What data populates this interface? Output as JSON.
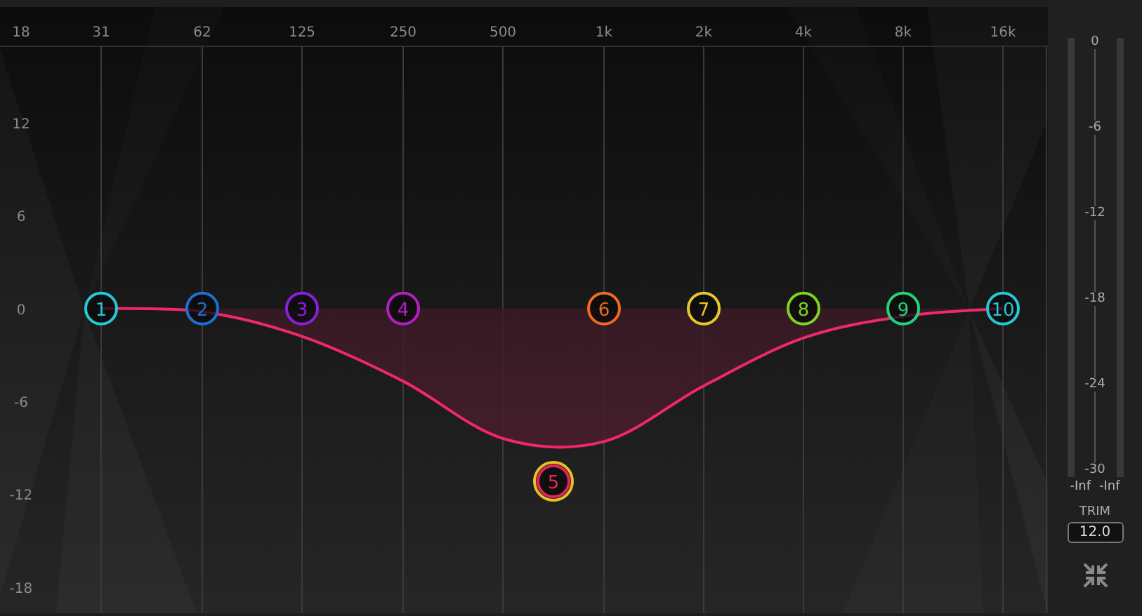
{
  "graph": {
    "chart_data": {
      "type": "area",
      "categories": [
        "31",
        "62",
        "125",
        "250",
        "500",
        "1k",
        "2k",
        "4k",
        "8k",
        "16k"
      ],
      "ylim": [
        -19.7,
        19.95
      ],
      "yticks": [
        18,
        12,
        6,
        0,
        -6,
        -12,
        -18
      ],
      "grid": true,
      "series": [
        {
          "color": "#f0286a",
          "values": [
            0,
            -0.2,
            -1.8,
            -4.7,
            -8.4,
            -8.6,
            -5.0,
            -1.9,
            -0.5,
            0
          ]
        }
      ]
    }
  },
  "bands": [
    {
      "label": "1",
      "color": "#22c9d6",
      "selected": false
    },
    {
      "label": "2",
      "color": "#1e6fd8",
      "selected": false
    },
    {
      "label": "3",
      "color": "#8a1fe0",
      "selected": false
    },
    {
      "label": "4",
      "color": "#b51cc8",
      "selected": false
    },
    {
      "label": "5",
      "color": "#e8245c",
      "selected": true
    },
    {
      "label": "6",
      "color": "#f06a1c",
      "selected": false
    },
    {
      "label": "7",
      "color": "#e8c72a",
      "selected": false
    },
    {
      "label": "8",
      "color": "#7ed321",
      "selected": false
    },
    {
      "label": "9",
      "color": "#22d37a",
      "selected": false
    },
    {
      "label": "10",
      "color": "#22c9d6",
      "selected": false
    }
  ],
  "meter": {
    "scale": [
      "0",
      "-6",
      "-12",
      "-18",
      "-24",
      "-30"
    ],
    "readings": [
      "-Inf",
      "-Inf"
    ]
  },
  "trim": {
    "label": "TRIM",
    "value": "12.0"
  }
}
